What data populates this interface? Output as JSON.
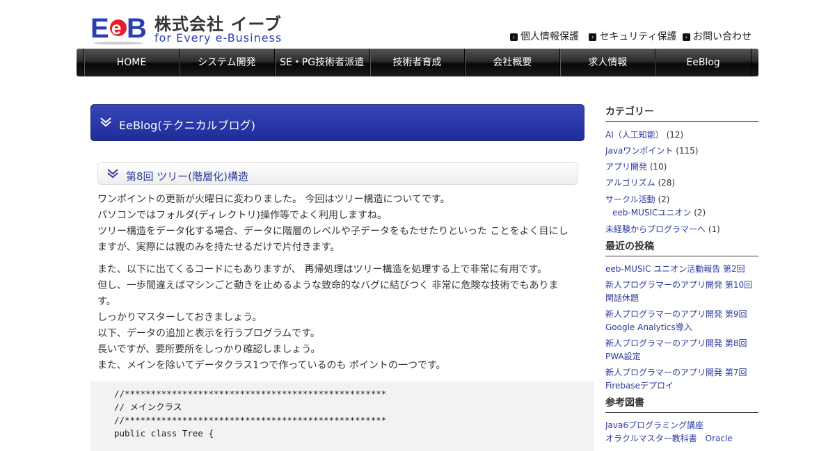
{
  "header": {
    "logo_mark": "EeB",
    "company_name": "株式会社 イーブ",
    "tagline": "for Every e-Business",
    "links": [
      "個人情報保護",
      "セキュリティ保護",
      "お問い合わせ"
    ]
  },
  "nav": {
    "items": [
      "HOME",
      "システム開発",
      "SE・PG技術者派遣",
      "技術者育成",
      "会社概要",
      "求人情報",
      "EeBlog"
    ]
  },
  "main": {
    "page_title": "EeBlog(テクニカルブログ)",
    "post_title": "第8回 ツリー(階層化)構造",
    "paragraphs": [
      [
        "ワンポイントの更新が火曜日に変わりました。 今回はツリー構造についてです。",
        "パソコンではフォルダ(ディレクトリ)操作等でよく利用しますね。",
        "ツリー構造をデータ化する場合、データに階層のレベルや子データをもたせたりといった ことをよく目にし",
        "ますが、実際には親のみを持たせるだけで片付きます。"
      ],
      [
        "また、以下に出てくるコードにもありますが、 再帰処理はツリー構造を処理する上で非常に有用です。",
        "但し、一歩間違えばマシンごと動きを止めるような致命的なバグに結びつく 非常に危険な技術でもありま",
        "す。",
        "しっかりマスターしておきましょう。",
        "以下、データの追加と表示を行うプログラムです。",
        "長いですが、要所要所をしっかり確認しましょう。",
        "また、メインを除いてデータクラス1つで作っているのも ポイントの一つです。"
      ]
    ],
    "code": "//**************************************************\n// メインクラス\n//**************************************************\npublic class Tree {"
  },
  "sidebar": {
    "categories_title": "カテゴリー",
    "categories": [
      {
        "label": "AI（人工知能）",
        "count": "(12)"
      },
      {
        "label": "Javaワンポイント",
        "count": "(115)"
      },
      {
        "label": "アプリ開発",
        "count": "(10)"
      },
      {
        "label": "アルゴリズム",
        "count": "(28)"
      },
      {
        "label": "サークル活動",
        "count": "(2)"
      },
      {
        "label": "eeb-MUSICユニオン",
        "count": "(2)"
      },
      {
        "label": "未経験からプログラマーへ",
        "count": "(1)"
      }
    ],
    "recent_title": "最近の投稿",
    "recent": [
      "eeb-MUSIC ユニオン活動報告 第2回",
      "新人プログラマーのアプリ開発 第10回 閑話休題",
      "新人プログラマーのアプリ開発 第9回 Google Analytics導入",
      "新人プログラマーのアプリ開発 第8回 PWA設定",
      "新人プログラマーのアプリ開発 第7回 Firebaseデプロイ"
    ],
    "books_title": "参考図書",
    "books": [
      "Java6プログラミング講座",
      "オラクルマスター教科書　Oracle"
    ]
  }
}
